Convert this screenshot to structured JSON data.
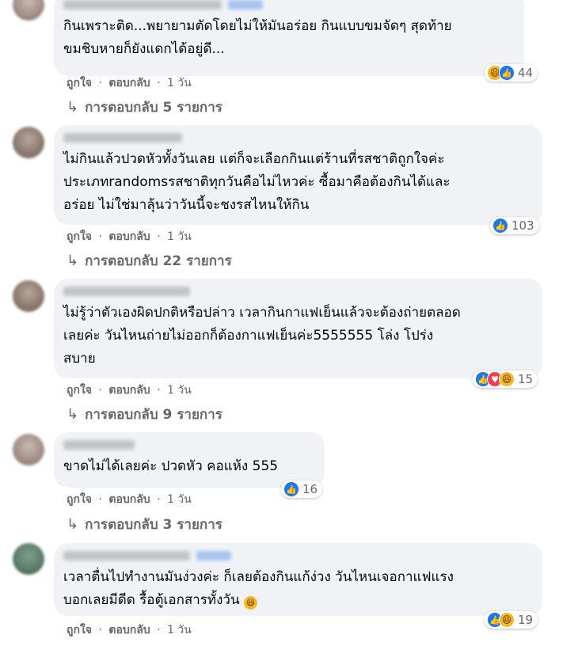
{
  "actions": {
    "like": "ถูกใจ",
    "reply": "ตอบกลับ",
    "dot": "·"
  },
  "comments": [
    {
      "text": "กินเพราะติด...พยายามตัดโดยไม่ให้มันอร่อย กินแบบขมจัดๆ สุดท้าย\nขมชิบหายก็ยังแดกได้อยู่ดี...",
      "reactions": [
        "haha-icon",
        "like-icon"
      ],
      "count": "44",
      "time": "1 วัน",
      "replies": "การตอบกลับ 5 รายการ"
    },
    {
      "text": "ไม่กินแล้วปวดหัวทั้งวันเลย แต่ก็จะเลือกกินแต่ร้านที่รสชาติถูกใจค่ะ\nประเภทrandomsรสชาติทุกวันคือไม่ไหวค่ะ ซื้อมาคือต้องกินได้และ\nอร่อย ไม่ใช่มาลุ้นว่าวันนี้จะชงรสไหนให้กิน",
      "reactions": [
        "like-icon"
      ],
      "count": "103",
      "time": "1 วัน",
      "replies": "การตอบกลับ 22 รายการ"
    },
    {
      "text": "ไม่รู้ว่าตัวเองผิดปกติหรือปล่าว เวลากินกาแฟเย็นแล้วจะต้องถ่ายตลอด\nเลยค่ะ วันไหนถ่ายไม่ออกก็ต้องกาแฟเย็นค่ะ5555555 โล่ง โปร่ง\nสบาย",
      "reactions": [
        "like-icon",
        "love-icon",
        "haha-icon"
      ],
      "count": "15",
      "time": "1 วัน",
      "replies": "การตอบกลับ 9 รายการ"
    },
    {
      "text": "ขาดไม่ได้เลยค่ะ ปวดหัว คอแห้ง 555",
      "reactions": [
        "like-icon"
      ],
      "count": "16",
      "time": "1 วัน",
      "replies": "การตอบกลับ 3 รายการ"
    },
    {
      "text": "เวลาตื่นไปทำงานมันง่วงค่ะ ก็เลยต้องกินแก้ง่วง วันไหนเจอกาแฟแรง\nบอกเลยมีดีด รื้อตู้เอกสารทั้งวัน",
      "emoji": "laughing-emoji",
      "reactions": [
        "like-icon",
        "haha-icon"
      ],
      "count": "19",
      "time": "1 วัน"
    }
  ],
  "colors": {
    "bubble": "#f0f2f5",
    "meta": "#65676b",
    "like": "#1877f2",
    "love": "#f33e58",
    "haha": "#f7b928"
  }
}
